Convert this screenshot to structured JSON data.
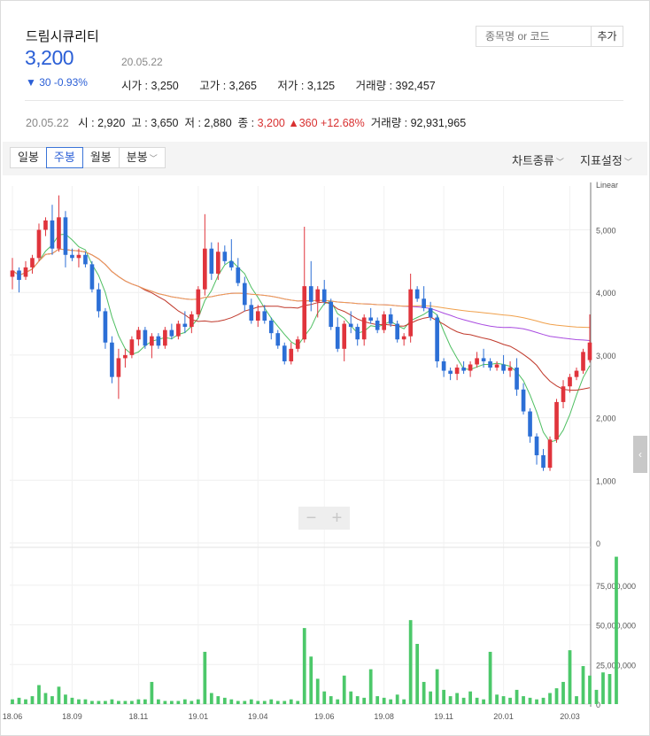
{
  "header": {
    "stock_name": "드림시큐리티",
    "price": "3,200",
    "change": "▼ 30 -0.93%",
    "date": "20.05.22",
    "open_label": "시가",
    "open": "3,250",
    "high_label": "고가",
    "high": "3,265",
    "low_label": "저가",
    "low": "3,125",
    "volume_label": "거래량",
    "volume": "392,457"
  },
  "search": {
    "placeholder": "종목명 or 코드",
    "add_label": "추가"
  },
  "weekly_summary": {
    "date": "20.05.22",
    "open": "시 : 2,920",
    "high": "고 : 3,650",
    "low": "저 : 2,880",
    "close_label": "종 :",
    "close": "3,200",
    "change": "▲360 +12.68%",
    "volume": "거래량 : 92,931,965"
  },
  "toolbar": {
    "tabs": [
      {
        "label": "일봉",
        "active": false
      },
      {
        "label": "주봉",
        "active": true
      },
      {
        "label": "월봉",
        "active": false
      },
      {
        "label": "분봉",
        "active": false,
        "dropdown": true
      }
    ],
    "chart_type_label": "차트종류",
    "indicator_label": "지표설정"
  },
  "colors": {
    "up": "#e0343c",
    "down": "#2c6fd6",
    "ma5": "#4fbf62",
    "ma20": "#c0392b",
    "ma60": "#a94be0",
    "ma120": "#f0a04b",
    "volume": "#4cc86a"
  },
  "chart_data": {
    "type": "candlestick",
    "scale_label": "Linear",
    "x_tick_labels": [
      "18.06",
      "18.09",
      "18.11",
      "19.01",
      "19.04",
      "19.06",
      "19.08",
      "19.11",
      "20.01",
      "20.03"
    ],
    "price_axis": {
      "ylim": [
        0,
        5700
      ],
      "ticks": [
        "0",
        "1,000",
        "2,000",
        "3,000",
        "4,000",
        "5,000"
      ],
      "tick_values": [
        0,
        1000,
        2000,
        3000,
        4000,
        5000
      ]
    },
    "volume_axis": {
      "ylim": [
        0,
        95000000
      ],
      "ticks": [
        "0",
        "25,000,000",
        "50,000,000",
        "75,000,000"
      ],
      "tick_values": [
        0,
        25000000,
        50000000,
        75000000
      ]
    },
    "candles": [
      [
        4250,
        4550,
        4050,
        4350
      ],
      [
        4350,
        4400,
        4000,
        4200
      ],
      [
        4250,
        4500,
        4200,
        4400
      ],
      [
        4400,
        4600,
        4300,
        4550
      ],
      [
        4550,
        5100,
        4500,
        5000
      ],
      [
        5000,
        5200,
        4900,
        5150
      ],
      [
        5150,
        5400,
        4600,
        4700
      ],
      [
        4700,
        5550,
        4650,
        5200
      ],
      [
        5200,
        5300,
        4400,
        4600
      ],
      [
        4600,
        4700,
        4500,
        4550
      ],
      [
        4550,
        4700,
        4400,
        4600
      ],
      [
        4600,
        4650,
        4400,
        4450
      ],
      [
        4450,
        4500,
        4000,
        4050
      ],
      [
        4050,
        4150,
        3600,
        3700
      ],
      [
        3700,
        3750,
        3100,
        3200
      ],
      [
        3200,
        3300,
        2550,
        2650
      ],
      [
        2650,
        3100,
        2300,
        2950
      ],
      [
        2950,
        3100,
        2800,
        3000
      ],
      [
        3000,
        3300,
        2950,
        3250
      ],
      [
        3250,
        3450,
        3150,
        3400
      ],
      [
        3400,
        3450,
        3100,
        3150
      ],
      [
        3150,
        3350,
        2950,
        3300
      ],
      [
        3300,
        3350,
        3100,
        3150
      ],
      [
        3150,
        3450,
        3100,
        3400
      ],
      [
        3400,
        3500,
        3250,
        3300
      ],
      [
        3300,
        3550,
        3250,
        3500
      ],
      [
        3500,
        3700,
        3350,
        3450
      ],
      [
        3450,
        3700,
        3350,
        3650
      ],
      [
        3650,
        4100,
        3600,
        4050
      ],
      [
        4050,
        5250,
        3950,
        4700
      ],
      [
        4700,
        4800,
        4200,
        4300
      ],
      [
        4300,
        4800,
        4200,
        4650
      ],
      [
        4650,
        4750,
        4450,
        4500
      ],
      [
        4500,
        4850,
        4350,
        4400
      ],
      [
        4400,
        4550,
        4100,
        4150
      ],
      [
        4150,
        4250,
        3700,
        3800
      ],
      [
        3800,
        3900,
        3500,
        3550
      ],
      [
        3550,
        3800,
        3450,
        3700
      ],
      [
        3700,
        3800,
        3500,
        3550
      ],
      [
        3550,
        3600,
        3250,
        3350
      ],
      [
        3350,
        3400,
        3100,
        3150
      ],
      [
        3150,
        3200,
        2850,
        2900
      ],
      [
        2900,
        3200,
        2850,
        3100
      ],
      [
        3100,
        3300,
        3050,
        3250
      ],
      [
        3250,
        5050,
        3200,
        4100
      ],
      [
        4100,
        4500,
        3700,
        3850
      ],
      [
        3850,
        4100,
        3600,
        4050
      ],
      [
        4050,
        4200,
        3800,
        3850
      ],
      [
        3850,
        3900,
        3400,
        3450
      ],
      [
        3450,
        3600,
        3050,
        3100
      ],
      [
        3100,
        3550,
        2900,
        3500
      ],
      [
        3500,
        3700,
        3350,
        3450
      ],
      [
        3450,
        3500,
        3150,
        3250
      ],
      [
        3250,
        3650,
        3150,
        3600
      ],
      [
        3600,
        3750,
        3500,
        3550
      ],
      [
        3550,
        3600,
        3350,
        3400
      ],
      [
        3400,
        3700,
        3350,
        3650
      ],
      [
        3650,
        3750,
        3450,
        3500
      ],
      [
        3500,
        3550,
        3200,
        3250
      ],
      [
        3250,
        3350,
        3150,
        3300
      ],
      [
        3300,
        4300,
        3200,
        4050
      ],
      [
        4050,
        4100,
        3850,
        3900
      ],
      [
        3900,
        4100,
        3700,
        3750
      ],
      [
        3750,
        3850,
        3550,
        3600
      ],
      [
        3600,
        3650,
        2800,
        2900
      ],
      [
        2900,
        2950,
        2650,
        2750
      ],
      [
        2750,
        2800,
        2600,
        2700
      ],
      [
        2700,
        2850,
        2600,
        2800
      ],
      [
        2800,
        2900,
        2700,
        2750
      ],
      [
        2750,
        2900,
        2650,
        2850
      ],
      [
        2850,
        3050,
        2800,
        2950
      ],
      [
        2950,
        3100,
        2800,
        2900
      ],
      [
        2900,
        2950,
        2750,
        2800
      ],
      [
        2800,
        2900,
        2750,
        2850
      ],
      [
        2850,
        3000,
        2700,
        2750
      ],
      [
        2750,
        2900,
        2650,
        2800
      ],
      [
        2800,
        2950,
        2350,
        2450
      ],
      [
        2450,
        2550,
        2050,
        2100
      ],
      [
        2100,
        2150,
        1600,
        1700
      ],
      [
        1700,
        1750,
        1250,
        1400
      ],
      [
        1400,
        1500,
        1150,
        1200
      ],
      [
        1200,
        1700,
        1150,
        1650
      ],
      [
        1650,
        2300,
        1600,
        2250
      ],
      [
        2250,
        2600,
        2150,
        2500
      ],
      [
        2500,
        2700,
        2400,
        2650
      ],
      [
        2650,
        2800,
        2600,
        2750
      ],
      [
        2750,
        3100,
        2700,
        3050
      ],
      [
        2920,
        3650,
        2880,
        3200
      ]
    ],
    "volume": [
      3,
      4,
      3,
      5,
      12,
      7,
      5,
      11,
      6,
      4,
      3,
      3,
      2,
      2,
      2,
      3,
      2,
      2,
      2,
      3,
      3,
      14,
      3,
      2,
      2,
      2,
      3,
      2,
      3,
      33,
      7,
      5,
      4,
      3,
      2,
      2,
      3,
      2,
      2,
      3,
      2,
      2,
      3,
      2,
      48,
      30,
      16,
      8,
      5,
      3,
      18,
      8,
      5,
      4,
      22,
      5,
      4,
      3,
      6,
      3,
      53,
      38,
      14,
      8,
      22,
      9,
      5,
      7,
      4,
      8,
      4,
      3,
      33,
      6,
      5,
      4,
      9,
      5,
      4,
      3,
      4,
      7,
      10,
      14,
      34,
      5,
      24,
      18,
      9,
      20,
      19,
      93
    ],
    "moving_averages": [
      {
        "name": "MA5",
        "color_key": "ma5",
        "period": 5
      },
      {
        "name": "MA20",
        "color_key": "ma20",
        "period": 20
      },
      {
        "name": "MA60",
        "color_key": "ma60",
        "period": 60
      },
      {
        "name": "MA120",
        "color_key": "ma120",
        "period": 120
      }
    ]
  },
  "zoom": {
    "minus": "−",
    "plus": "+"
  },
  "side_tab": "‹"
}
